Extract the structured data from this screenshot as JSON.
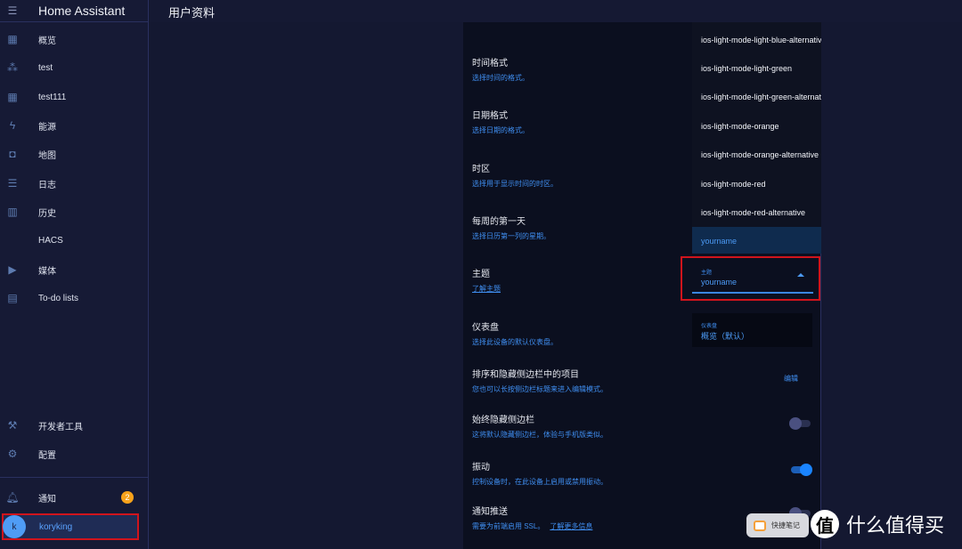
{
  "sidebar": {
    "title": "Home Assistant",
    "items": [
      {
        "label": "概览",
        "icon": "dashboard-icon"
      },
      {
        "label": "test",
        "icon": "people-icon"
      },
      {
        "label": "test111",
        "icon": "dashboard-icon"
      },
      {
        "label": "能源",
        "icon": "lightning-icon"
      },
      {
        "label": "地图",
        "icon": "map-account-icon"
      },
      {
        "label": "日志",
        "icon": "list-icon"
      },
      {
        "label": "历史",
        "icon": "chart-box-icon"
      },
      {
        "label": "HACS",
        "icon": ""
      },
      {
        "label": "媒体",
        "icon": "play-box-icon"
      },
      {
        "label": "To-do lists",
        "icon": "clipboard-list-icon"
      }
    ],
    "dev_tools": "开发者工具",
    "settings": "配置",
    "notifications": "通知",
    "notification_count": "2",
    "user": {
      "initial": "k",
      "name": "koryking"
    }
  },
  "header": {
    "title": "用户资料"
  },
  "settings": {
    "time_format": {
      "title": "时间格式",
      "desc": "选择时间的格式。"
    },
    "date_format": {
      "title": "日期格式",
      "desc": "选择日期的格式。"
    },
    "timezone": {
      "title": "时区",
      "desc": "选择用于显示时间的时区。"
    },
    "first_weekday": {
      "title": "每周的第一天",
      "desc": "选择日历第一列的星期。"
    },
    "theme": {
      "title": "主题",
      "link": "了解主题",
      "field_label": "主题",
      "value": "yourname"
    },
    "dashboard": {
      "title": "仪表盘",
      "desc": "选择此设备的默认仪表盘。",
      "field_label": "仪表盘",
      "value": "概览（默认）"
    },
    "sidebar_order": {
      "title": "排序和隐藏侧边栏中的项目",
      "desc": "您也可以长按侧边栏标题来进入编辑模式。",
      "button": "编辑"
    },
    "hide_sidebar": {
      "title": "始终隐藏侧边栏",
      "desc": "这将默认隐藏侧边栏，体验与手机版类似。",
      "on": false
    },
    "vibrate": {
      "title": "振动",
      "desc": "控制设备时，在此设备上启用或禁用振动。",
      "on": true
    },
    "push": {
      "title": "通知推送",
      "desc": "需要为前端启用 SSL。",
      "link": "了解更多信息"
    }
  },
  "theme_menu": {
    "options": [
      "ios-light-mode-light-blue-alternative",
      "ios-light-mode-light-green",
      "ios-light-mode-light-green-alternative",
      "ios-light-mode-orange",
      "ios-light-mode-orange-alternative",
      "ios-light-mode-red",
      "ios-light-mode-red-alternative"
    ],
    "selected": "yourname"
  },
  "overlay": {
    "note_label": "快捷笔记",
    "watermark": "什么值得买",
    "watermark_logo": "值"
  },
  "colors": {
    "accent": "#3f8ef0",
    "highlight": "#d0141c",
    "badge": "#f7a21b"
  }
}
